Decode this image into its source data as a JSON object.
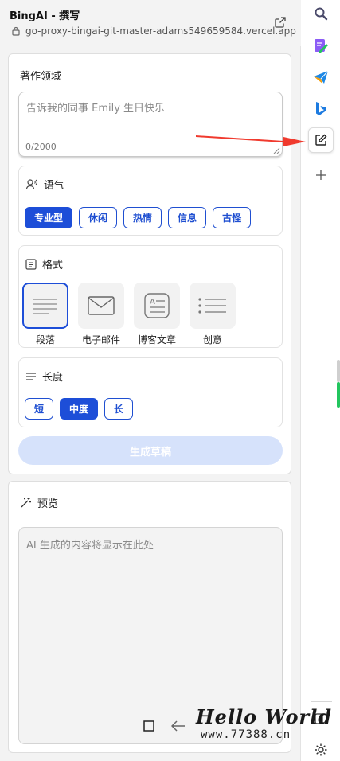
{
  "header": {
    "title": "BingAI - 撰写",
    "url": "go-proxy-bingai-git-master-adams549659584.vercel.app"
  },
  "compose": {
    "section_title": "著作领域",
    "input_placeholder": "告诉我的同事 Emily 生日快乐",
    "char_count": "0/2000",
    "tone": {
      "label": "语气",
      "options": [
        "专业型",
        "休闲",
        "热情",
        "信息",
        "古怪"
      ],
      "selected": "专业型"
    },
    "format": {
      "label": "格式",
      "options": [
        "段落",
        "电子邮件",
        "博客文章",
        "创意"
      ],
      "selected": "段落"
    },
    "length": {
      "label": "长度",
      "options": [
        "短",
        "中度",
        "长"
      ],
      "selected": "中度"
    },
    "generate_label": "生成草稿"
  },
  "preview": {
    "title": "预览",
    "placeholder": "AI 生成的内容将显示在此处"
  },
  "sidebar": {
    "items": [
      "search",
      "edit-pen",
      "send",
      "bing",
      "compose",
      "add"
    ],
    "active": "compose"
  },
  "watermark": {
    "line1": "Hello World",
    "line2": "www.77388.cn"
  },
  "colors": {
    "accent": "#1d4ed8",
    "disabled_button": "#d6e2fb",
    "arrow": "#f03a2e"
  }
}
